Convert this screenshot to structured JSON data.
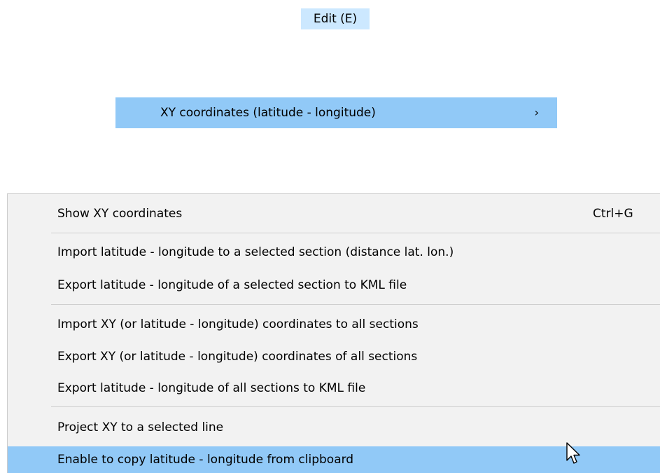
{
  "menubar": {
    "edit_label": "Edit (E)"
  },
  "submenu_parent": {
    "label": "XY coordinates (latitude - longitude)",
    "arrow": "›"
  },
  "dropdown": {
    "items": [
      {
        "label": "Show XY coordinates",
        "shortcut": "Ctrl+G"
      },
      {
        "label": "Import latitude - longitude to a selected section (distance lat. lon.)",
        "shortcut": ""
      },
      {
        "label": "Export latitude - longitude of a selected section to KML file",
        "shortcut": ""
      },
      {
        "label": "Import XY (or latitude - longitude) coordinates to all sections",
        "shortcut": ""
      },
      {
        "label": "Export XY (or latitude - longitude) coordinates of all sections",
        "shortcut": ""
      },
      {
        "label": "Export latitude - longitude of all sections to KML file",
        "shortcut": ""
      },
      {
        "label": "Project XY to a selected line",
        "shortcut": ""
      },
      {
        "label": "Enable to copy latitude - longitude from clipboard",
        "shortcut": ""
      }
    ]
  },
  "colors": {
    "menubar_highlight": "#cce8ff",
    "item_highlight": "#91c9f7",
    "menu_background": "#f2f2f2",
    "separator": "#cfcfcf"
  },
  "icons": {
    "cursor": "arrow-pointer-icon",
    "submenu_arrow": "chevron-right-icon"
  }
}
